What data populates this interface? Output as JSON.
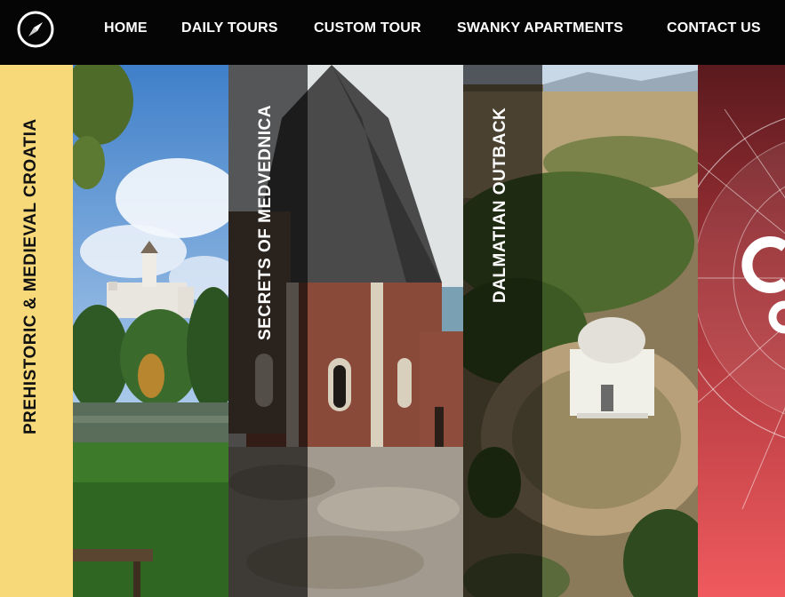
{
  "nav": {
    "logo_icon": "compass-icon",
    "links": [
      "HOME",
      "DAILY TOURS",
      "CUSTOM TOUR",
      "SWANKY APARTMENTS",
      "CONTACT US"
    ]
  },
  "tours": [
    {
      "title": "PREHISTORIC & MEDIEVAL CROATIA",
      "image": "castle-lake-photo"
    },
    {
      "title": "SECRETS OF MEDVEDNICA",
      "image": "stone-tower-photo"
    },
    {
      "title": "DALMATIAN OUTBACK",
      "image": "domed-chapel-aerial-photo"
    }
  ],
  "colors": {
    "nav_bg": "#050505",
    "tab_yellow": "#f7d97a",
    "label_dark": "#111111",
    "label_light": "#ffffff",
    "promo_red": "#e8565b"
  }
}
